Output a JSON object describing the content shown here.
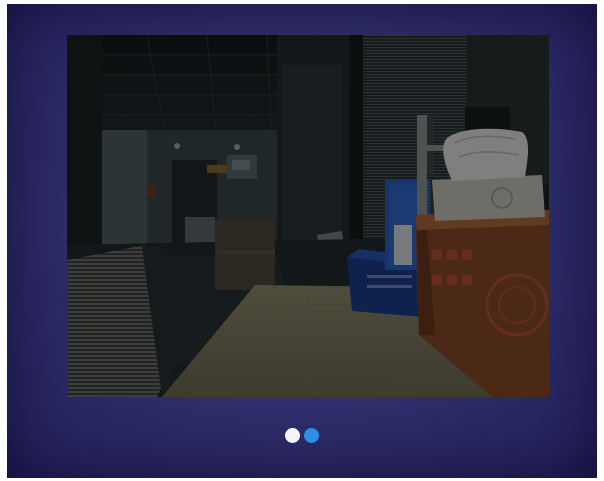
{
  "viewer": {
    "image_alt": "",
    "active_index": 1,
    "slides": [
      {
        "color": "#f4f4f6"
      },
      {
        "color": "#2f8ee8"
      }
    ]
  },
  "colors": {
    "frame_background": "#302e6c",
    "photo_darkening": "#000000"
  }
}
